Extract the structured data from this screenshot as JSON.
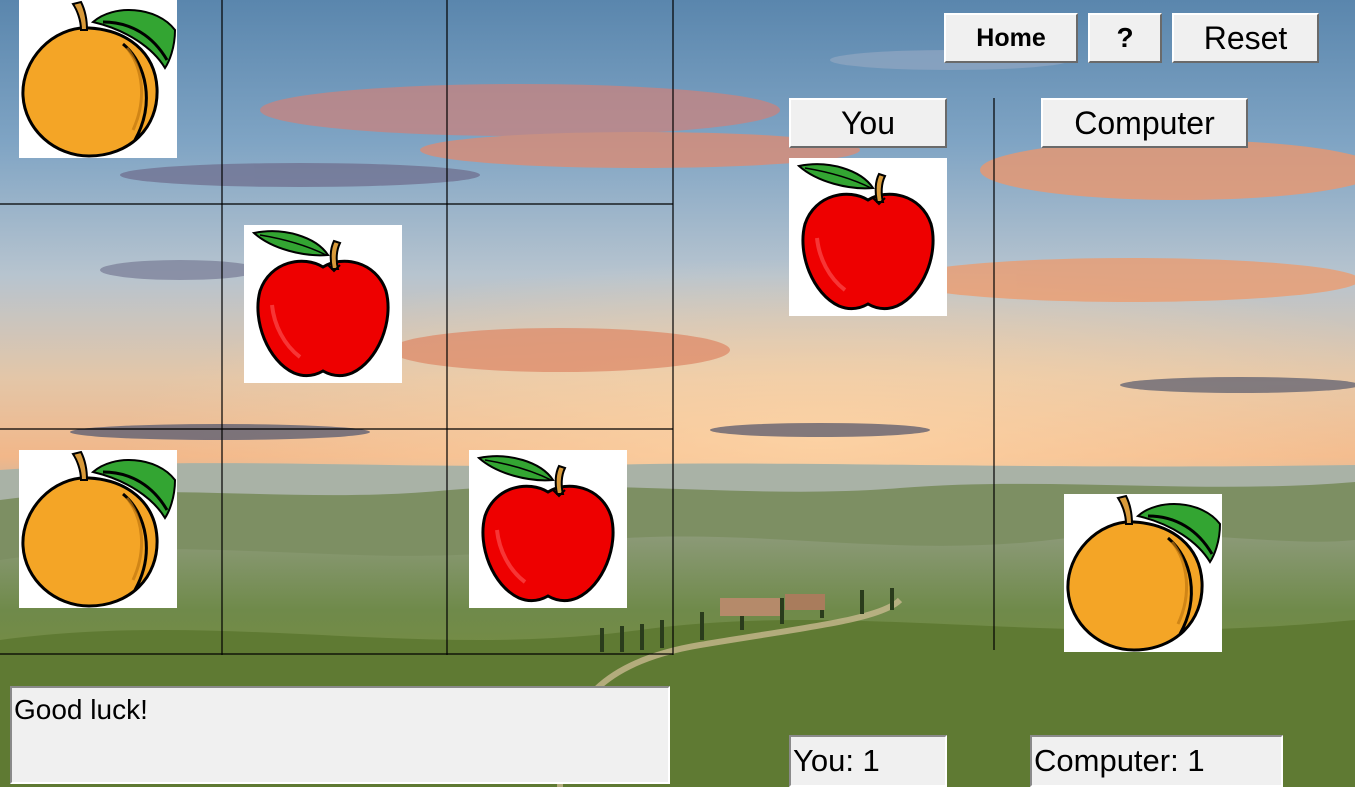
{
  "toolbar": {
    "home_label": "Home",
    "help_label": "?",
    "reset_label": "Reset"
  },
  "players": {
    "you_label": "You",
    "computer_label": "Computer",
    "you_piece": "apple-icon",
    "computer_piece": "peach-icon"
  },
  "board": {
    "rows": 3,
    "cols": 3,
    "cells": [
      [
        "peach",
        "",
        ""
      ],
      [
        "",
        "apple",
        ""
      ],
      [
        "peach",
        "",
        "apple"
      ]
    ]
  },
  "message": "Good luck!",
  "score": {
    "you": "You: 1",
    "computer": "Computer: 1"
  },
  "colors": {
    "apple": "#ee0000",
    "peach": "#f4a526",
    "leaf": "#33a532",
    "stem": "#d89a3a",
    "button_face": "#f0f0f0"
  }
}
